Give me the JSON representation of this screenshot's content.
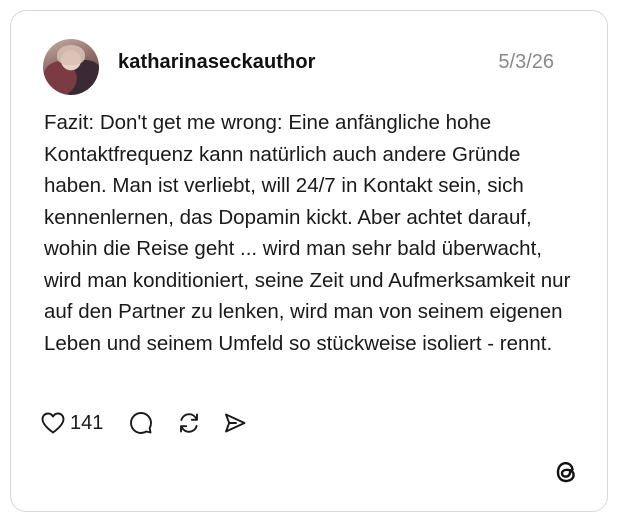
{
  "post": {
    "username": "katharinaseckauthor",
    "date": "5/3/26",
    "text": "Fazit: Don't get me wrong: Eine anfängliche hohe Kontaktfrequenz kann natürlich auch andere Gründe haben. Man ist verliebt, will 24/7 in Kontakt sein, sich kennenlernen, das Dopamin kickt. Aber achtet darauf, wohin die Reise geht ... wird man sehr bald überwacht, wird man konditioniert, seine Zeit und Aufmerksamkeit nur auf den Partner zu lenken, wird man von seinem eigenen Leben und seinem Umfeld so stückweise isoliert - rennt."
  },
  "actions": {
    "like_count": "141",
    "like_icon": "heart-icon",
    "reply_icon": "comment-icon",
    "repost_icon": "repost-icon",
    "share_icon": "send-icon"
  },
  "brand": {
    "logo_icon": "threads-logo-icon"
  },
  "colors": {
    "border": "#d9d9d9",
    "text": "#1a1a1a",
    "muted": "#8a8a8a"
  }
}
